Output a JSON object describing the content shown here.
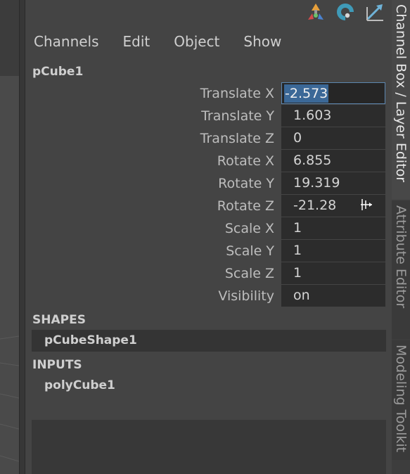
{
  "menubar": {
    "items": [
      "Channels",
      "Edit",
      "Object",
      "Show"
    ]
  },
  "toolbar": {
    "icons": [
      "transform-axes-icon",
      "refresh-arc-icon",
      "edit-arrow-icon"
    ]
  },
  "object": {
    "name": "pCube1"
  },
  "attributes": [
    {
      "label": "Translate X",
      "value": "-2.573"
    },
    {
      "label": "Translate Y",
      "value": "1.603"
    },
    {
      "label": "Translate Z",
      "value": "0"
    },
    {
      "label": "Rotate X",
      "value": "6.855"
    },
    {
      "label": "Rotate Y",
      "value": "19.319"
    },
    {
      "label": "Rotate Z",
      "value": "-21.28"
    },
    {
      "label": "Scale X",
      "value": "1"
    },
    {
      "label": "Scale Y",
      "value": "1"
    },
    {
      "label": "Scale Z",
      "value": "1"
    },
    {
      "label": "Visibility",
      "value": "on"
    }
  ],
  "shapes": {
    "header": "SHAPES",
    "items": [
      "pCubeShape1"
    ]
  },
  "inputs": {
    "header": "INPUTS",
    "items": [
      "polyCube1"
    ]
  },
  "side_tabs": {
    "channel_box": "Channel Box / Layer Editor",
    "attribute_editor": "Attribute Editor",
    "modeling_toolkit": "Modeling Toolkit"
  },
  "colors": {
    "panel_bg": "#444444",
    "field_bg": "#2c2c2c",
    "selection_highlight": "#3b6897"
  }
}
